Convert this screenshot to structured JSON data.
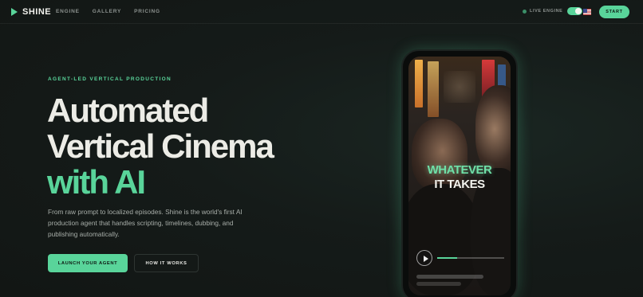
{
  "nav": {
    "brand": "SHINE",
    "links": [
      "ENGINE",
      "GALLERY",
      "PRICING"
    ],
    "live_label": "LIVE ENGINE",
    "live_engine_on": true,
    "flag": "us-flag-icon",
    "start_label": "START"
  },
  "hero": {
    "eyebrow": "AGENT-LED VERTICAL PRODUCTION",
    "headline_line1": "Automated",
    "headline_line2": "Vertical Cinema",
    "headline_line3": "with AI",
    "description": "From raw prompt to localized episodes. Shine is the world's first AI production agent that handles scripting, timelines, dubbing, and publishing automatically.",
    "primary_cta": "LAUNCH YOUR AGENT",
    "secondary_cta": "HOW IT WORKS"
  },
  "phone": {
    "caption_line1": "WHATEVER",
    "caption_line2": "IT TAKES",
    "progress": 0.3
  },
  "colors": {
    "accent": "#59d49a",
    "background": "#151b19"
  }
}
